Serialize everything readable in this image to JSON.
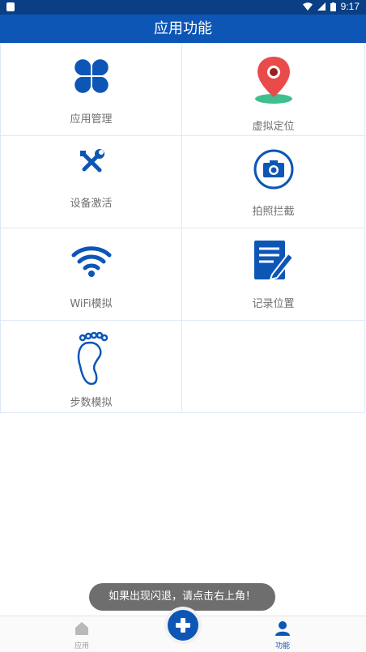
{
  "status": {
    "time": "9:17"
  },
  "header": {
    "title": "应用功能"
  },
  "features": [
    {
      "label": "应用管理",
      "icon": "clover-icon"
    },
    {
      "label": "虚拟定位",
      "icon": "map-pin-icon"
    },
    {
      "label": "设备激活",
      "icon": "tools-icon"
    },
    {
      "label": "拍照拦截",
      "icon": "camera-icon"
    },
    {
      "label": "WiFi模拟",
      "icon": "wifi-icon"
    },
    {
      "label": "记录位置",
      "icon": "notepad-icon"
    },
    {
      "label": "步数模拟",
      "icon": "footprint-icon"
    }
  ],
  "toast": {
    "text": "如果出现闪退，请点击右上角！"
  },
  "bottom_nav": {
    "tabs": [
      {
        "label": "应用",
        "icon": "home-icon",
        "color": "#9e9e9e"
      },
      {
        "label": "功能",
        "icon": "person-icon",
        "color": "#0d56b6"
      }
    ],
    "fab_icon": "plus-icon"
  },
  "colors": {
    "primary": "#0d56b6",
    "statusbar": "#0a3f86",
    "pin_red": "#e94b4b",
    "pin_base": "#3fbf8f"
  }
}
